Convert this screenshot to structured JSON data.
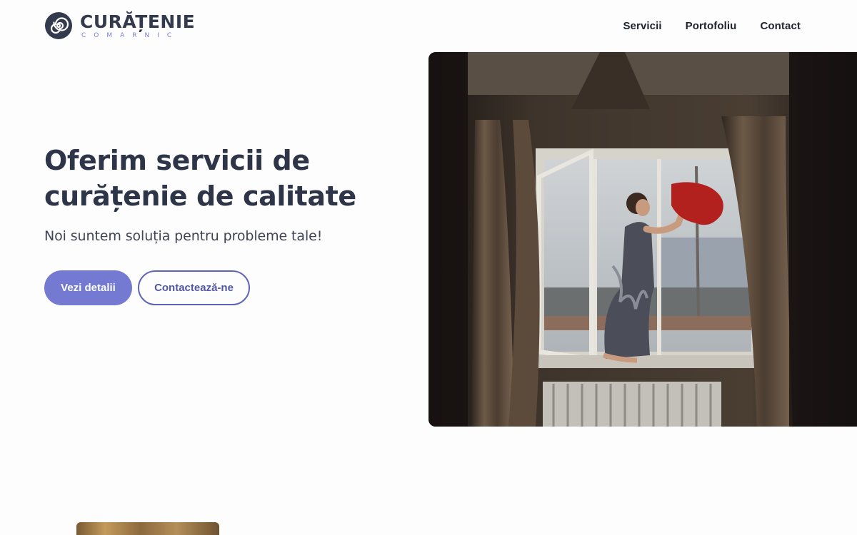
{
  "brand": {
    "name": "CURĂȚENIE",
    "tagline": "COMARNIC",
    "icon": "spiral-logo-icon"
  },
  "nav": {
    "items": [
      {
        "label": "Servicii"
      },
      {
        "label": "Portofoliu"
      },
      {
        "label": "Contact"
      }
    ]
  },
  "hero": {
    "title": "Oferim servicii de curățenie de calitate",
    "subtitle": "Noi suntem soluția pentru probleme tale!",
    "primary_button": "Vezi detalii",
    "secondary_button": "Contactează-ne",
    "image_subject": "woman-cleaning-window-photo"
  },
  "colors": {
    "accent": "#7479d2",
    "accent_dark": "#5157a8",
    "text_dark": "#2f3548"
  }
}
